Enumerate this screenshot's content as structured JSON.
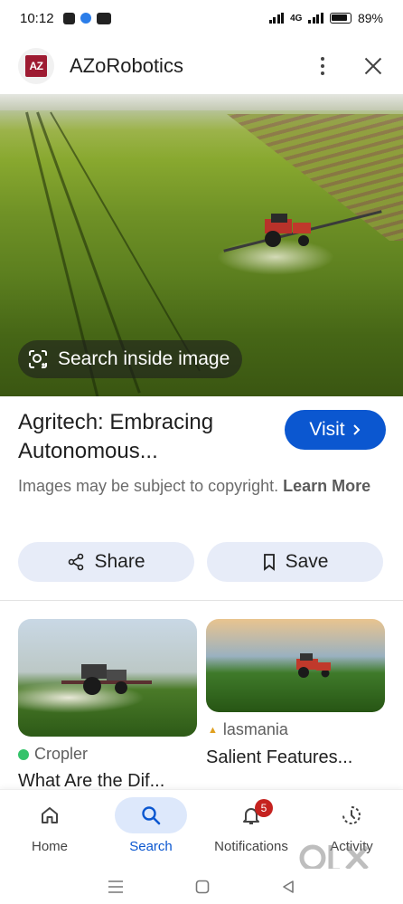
{
  "status_bar": {
    "time": "10:12",
    "battery": "89%",
    "network": "4G"
  },
  "header": {
    "logo_text": "AZ",
    "site_name": "AZoRobotics",
    "more_icon": "more-vert-icon",
    "close_icon": "close-icon"
  },
  "image": {
    "search_inside_label": "Search inside image"
  },
  "result": {
    "title_line1": "Agritech: Embracing",
    "title_line2": "Autonomous...",
    "visit_label": "Visit",
    "copyright_text": "Images may be subject to copyright.",
    "learn_more": "Learn More"
  },
  "actions": {
    "share_label": "Share",
    "save_label": "Save"
  },
  "related": [
    {
      "source": "Cropler",
      "title": "What Are the Dif..."
    },
    {
      "source": "lasmania",
      "title": "Salient Features..."
    }
  ],
  "bottom_nav": {
    "items": [
      {
        "label": "Home",
        "icon": "home-icon"
      },
      {
        "label": "Search",
        "icon": "search-icon"
      },
      {
        "label": "Notifications",
        "icon": "bell-icon",
        "badge": "5"
      },
      {
        "label": "Activity",
        "icon": "activity-icon"
      }
    ]
  },
  "colors": {
    "accent": "#0b57d0",
    "pill_bg": "#e7ecf8",
    "badge": "#c5221f"
  }
}
